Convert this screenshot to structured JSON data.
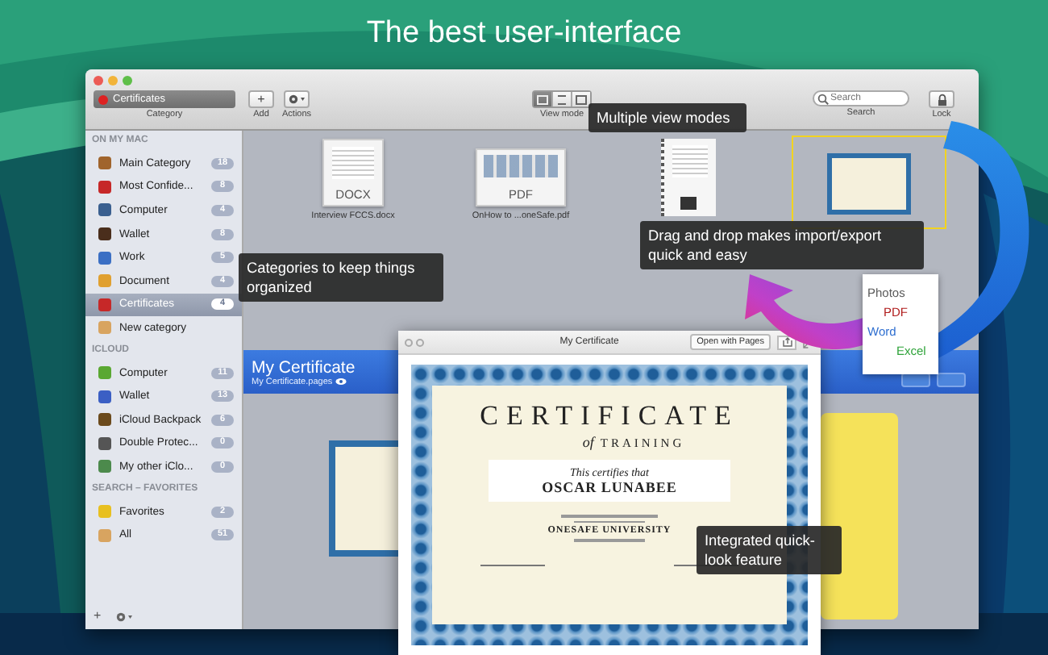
{
  "headline": "The best user-interface",
  "toolbar": {
    "category": {
      "value": "Certificates",
      "label": "Category"
    },
    "add": {
      "symbol": "+",
      "label": "Add"
    },
    "actions": {
      "label": "Actions"
    },
    "view_modes": {
      "label": "View mode",
      "modes": [
        {
          "selected": true
        },
        {
          "selected": false
        },
        {
          "selected": false
        }
      ]
    },
    "search": {
      "placeholder": "Search",
      "label": "Search"
    },
    "lock": {
      "label": "Lock"
    }
  },
  "sidebar": {
    "sections": [
      {
        "title": "ON MY MAC",
        "items": [
          {
            "label": "Main Category",
            "count": "18",
            "selected": false,
            "color": "#a0642c"
          },
          {
            "label": "Most Confide...",
            "count": "8",
            "selected": false,
            "color": "#c62828"
          },
          {
            "label": "Computer",
            "count": "4",
            "selected": false,
            "color": "#3a5f8f"
          },
          {
            "label": "Wallet",
            "count": "8",
            "selected": false,
            "color": "#4a2e1c"
          },
          {
            "label": "Work",
            "count": "5",
            "selected": false,
            "color": "#3b6fc4"
          },
          {
            "label": "Document",
            "count": "4",
            "selected": false,
            "color": "#e0a030"
          },
          {
            "label": "Certificates",
            "count": "4",
            "selected": true,
            "color": "#c62828"
          },
          {
            "label": "New category",
            "selected": false,
            "color": "#d8a460"
          }
        ]
      },
      {
        "title": "ICLOUD",
        "items": [
          {
            "label": "Computer",
            "count": "11",
            "selected": false,
            "color": "#5aa832"
          },
          {
            "label": "Wallet",
            "count": "13",
            "selected": false,
            "color": "#3b5fc4"
          },
          {
            "label": "iCloud Backpack",
            "count": "6",
            "selected": false,
            "color": "#6b4a1c"
          },
          {
            "label": "Double Protec...",
            "count": "0",
            "selected": false,
            "color": "#555555"
          },
          {
            "label": "My other iClo...",
            "count": "0",
            "selected": false,
            "color": "#4c8a4c"
          }
        ]
      },
      {
        "title": "SEARCH – FAVORITES",
        "items": [
          {
            "label": "Favorites",
            "count": "2",
            "selected": false,
            "color": "#e8c020"
          },
          {
            "label": "All",
            "count": "51",
            "selected": false,
            "color": "#d8a460"
          }
        ]
      }
    ],
    "footer_add": "+"
  },
  "files": [
    {
      "kind": "docx",
      "badge": "DOCX",
      "name": "Interview FCCS.docx",
      "selected": false
    },
    {
      "kind": "pdf",
      "badge": "PDF",
      "name": "OnHow to ...oneSafe.pdf",
      "selected": false
    },
    {
      "kind": "scan",
      "selected": false
    },
    {
      "kind": "certificate",
      "selected": true
    }
  ],
  "detail": {
    "title": "My Certificate",
    "file": "My Certificate.pages"
  },
  "quick_look": {
    "title": "My Certificate",
    "open_button": "Open with Pages",
    "certificate": {
      "heading": "CERTIFICATE",
      "of": "of",
      "subheading": "TRAINING",
      "certifies": "This certifies that",
      "name": "OSCAR LUNABEE",
      "institution": "ONESAFE UNIVERSITY"
    }
  },
  "callouts": [
    {
      "text": "Multiple view modes"
    },
    {
      "text": "Categories to keep things organized"
    },
    {
      "text": "Drag and drop makes import/export quick and easy"
    },
    {
      "text": "Integrated quick-look feature"
    }
  ],
  "formats": [
    {
      "label": "Photos",
      "color": "#5a5a5a"
    },
    {
      "label": "PDF",
      "color": "#b01c1c"
    },
    {
      "label": "Word",
      "color": "#2f6fd0"
    },
    {
      "label": "Excel",
      "color": "#2fa33a"
    }
  ]
}
